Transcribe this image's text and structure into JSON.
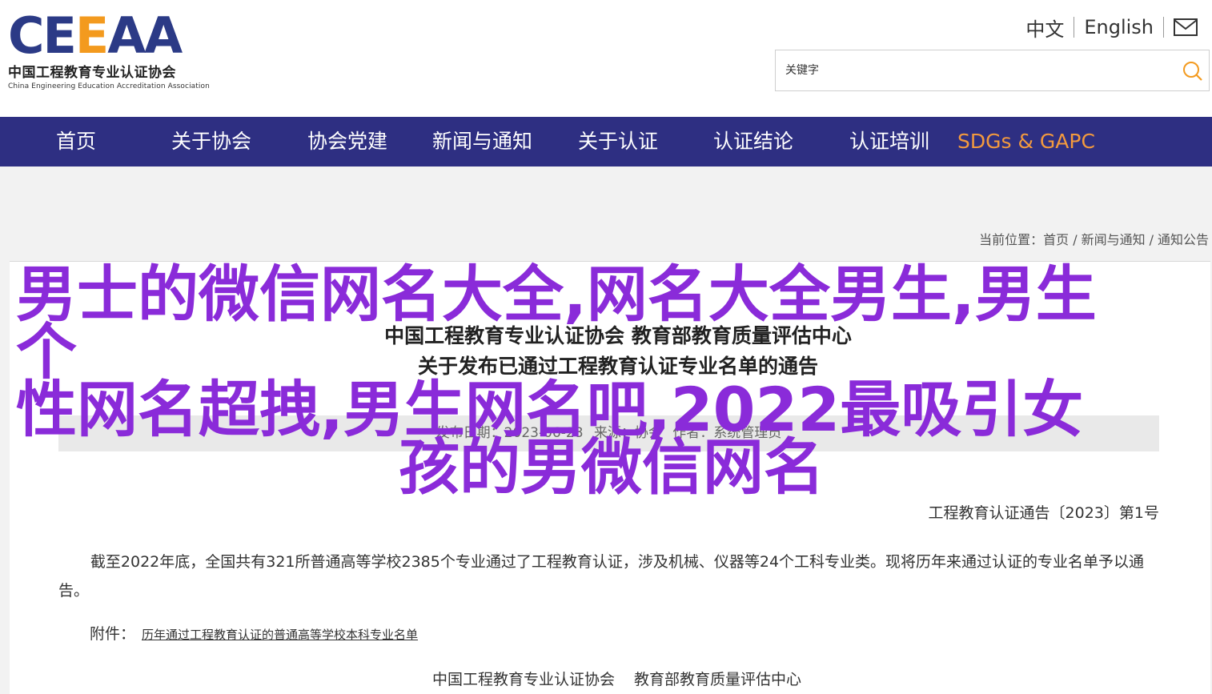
{
  "header": {
    "logo_mark_1": "CE",
    "logo_mark_2": "E",
    "logo_mark_3": "AA",
    "logo_cn": "中国工程教育专业认证协会",
    "logo_en": "China Engineering Education Accreditation Association",
    "lang_cn": "中文",
    "lang_en": "English",
    "search_placeholder": "关键字"
  },
  "nav": {
    "items": [
      {
        "label": "首页"
      },
      {
        "label": "关于协会"
      },
      {
        "label": "协会党建"
      },
      {
        "label": "新闻与通知"
      },
      {
        "label": "关于认证"
      },
      {
        "label": "认证结论"
      },
      {
        "label": "认证培训"
      },
      {
        "label": "SDGs & GAPC"
      }
    ],
    "highlight_color": "#f39a3e",
    "bg_color": "#2e2f82"
  },
  "breadcrumb": {
    "prefix": "当前位置：",
    "items": [
      "首页",
      "新闻与通知",
      "通知公告"
    ]
  },
  "article": {
    "title_line1": "中国工程教育专业认证协会 教育部教育质量评估中心",
    "title_line2": "关于发布已通过工程教育认证专业名单的通告",
    "meta_date": "发布日期：2023-06-28",
    "meta_source": "来源：协会",
    "meta_author": "作者：系统管理员",
    "notice_no": "工程教育认证通告〔2023〕第1号",
    "paragraph": "截至2022年底，全国共有321所普通高等学校2385个专业通过了工程教育认证，涉及机械、仪器等24个工科专业类。现将历年来通过认证的专业名单予以通告。",
    "attach_label": "附件：",
    "attach_link": "历年通过工程教育认证的普通高等学校本科专业名单",
    "sign_1": "中国工程教育专业认证协会",
    "sign_2": "教育部教育质量评估中心"
  },
  "overlay": {
    "line1": "男士的微信网名大全,网名大全男生,男生个",
    "line2": "性网名超拽,男生网名吧,2022最吸引女",
    "line3": "孩的男微信网名",
    "color": "#8a2bd9"
  }
}
